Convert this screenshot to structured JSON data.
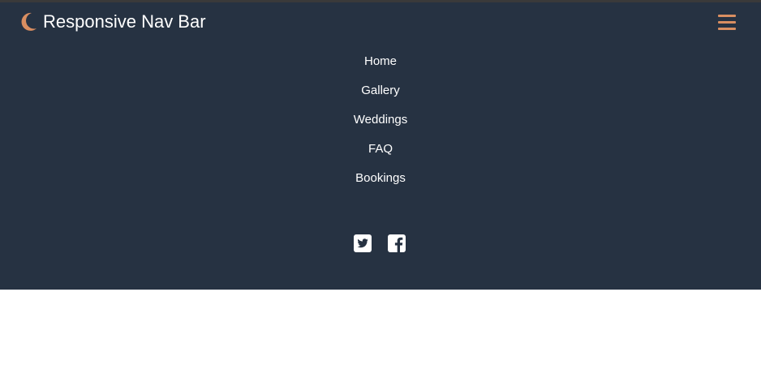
{
  "brand": {
    "icon": "moon-icon",
    "title": "Responsive Nav Bar"
  },
  "menu_toggle": {
    "icon": "hamburger-icon"
  },
  "nav": {
    "items": [
      {
        "label": "Home"
      },
      {
        "label": "Gallery"
      },
      {
        "label": "Weddings"
      },
      {
        "label": "FAQ"
      },
      {
        "label": "Bookings"
      }
    ]
  },
  "social": [
    {
      "icon": "twitter-icon"
    },
    {
      "icon": "facebook-icon"
    }
  ],
  "colors": {
    "navbar_bg": "#263242",
    "accent": "#d98e61",
    "text": "#ffffff",
    "page_bg": "#ffffff"
  }
}
